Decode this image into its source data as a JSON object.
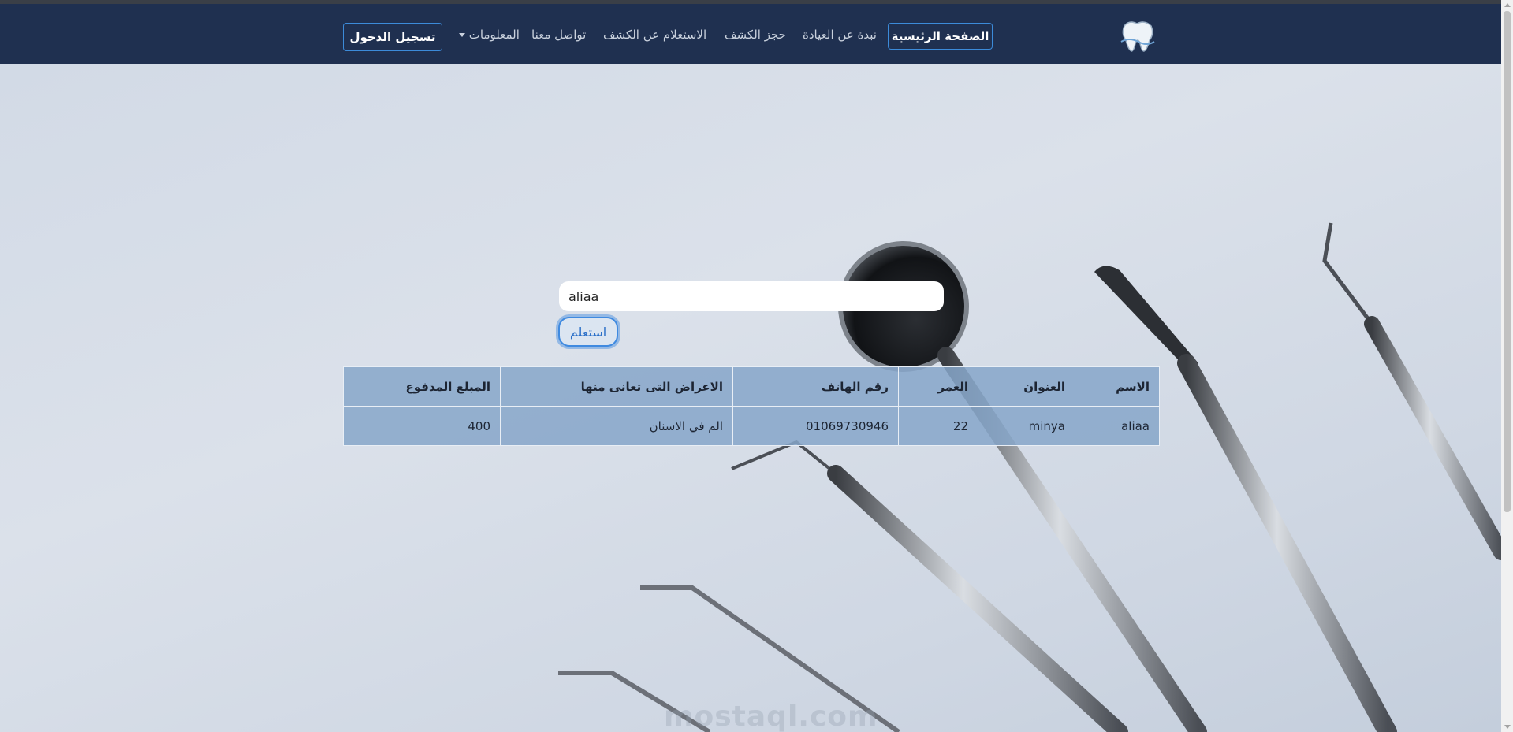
{
  "nav": {
    "home": "الصفحة الرئيسية",
    "about": "نبذة عن العيادة",
    "booking": "حجز الكشف",
    "inquiry": "الاستعلام عن الكشف",
    "contact": "تواصل معنا",
    "info": "المعلومات",
    "login": "تسجيل الدخول"
  },
  "search": {
    "value": "aliaa",
    "button": "استعلم"
  },
  "table": {
    "headers": {
      "name": "الاسم",
      "address": "العنوان",
      "age": "العمر",
      "phone": "رقم الهاتف",
      "symptoms": "الاعراض التى تعانى منها",
      "paid": "المبلغ المدفوع"
    },
    "rows": [
      {
        "name": "aliaa",
        "address": "minya",
        "age": "22",
        "phone": "01069730946",
        "symptoms": "الم في الاسنان",
        "paid": "400"
      }
    ]
  },
  "watermark": "mostaql.com",
  "colors": {
    "navbar": "#1f3050",
    "accent": "#3c8bd9",
    "table_bg": "#86a6c9"
  }
}
